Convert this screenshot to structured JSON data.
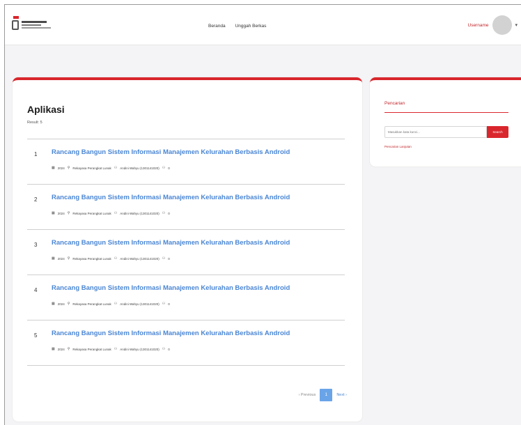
{
  "nav": {
    "links": [
      "Beranda",
      "Unggah Berkas"
    ],
    "username": "Username"
  },
  "main": {
    "title": "Aplikasi",
    "result": "Result: 5",
    "items": [
      {
        "num": "1",
        "title": "Rancang Bangun Sistem Informasi Manajemen Kelurahan Berbasis Android",
        "year": "2024",
        "category": "Rekayasa Perangkat Lunak",
        "author": "Andini Wahyu (1301141020)",
        "count": "0"
      },
      {
        "num": "2",
        "title": "Rancang Bangun Sistem Informasi Manajemen Kelurahan Berbasis Android",
        "year": "2024",
        "category": "Rekayasa Perangkat Lunak",
        "author": "Andini Wahyu (1301141020)",
        "count": "0"
      },
      {
        "num": "3",
        "title": "Rancang Bangun Sistem Informasi Manajemen Kelurahan Berbasis Android",
        "year": "2024",
        "category": "Rekayasa Perangkat Lunak",
        "author": "Andini Wahyu (1301141020)",
        "count": "0"
      },
      {
        "num": "4",
        "title": "Rancang Bangun Sistem Informasi Manajemen Kelurahan Berbasis Android",
        "year": "2024",
        "category": "Rekayasa Perangkat Lunak",
        "author": "Andini Wahyu (1301141020)",
        "count": "0"
      },
      {
        "num": "5",
        "title": "Rancang Bangun Sistem Informasi Manajemen Kelurahan Berbasis Android",
        "year": "2024",
        "category": "Rekayasa Perangkat Lunak",
        "author": "Andini Wahyu (1301141020)",
        "count": "0"
      }
    ],
    "pagination": {
      "previous": "‹ Previous",
      "current": "1",
      "next": "Next ›"
    }
  },
  "side": {
    "title": "Pencarian",
    "search_placeholder": "Masukkan kata kunci...",
    "search_button": "Search",
    "advanced_link": "Pencarian Lanjutan"
  },
  "colors": {
    "accent": "#d9262c",
    "link": "#4a86d4"
  }
}
